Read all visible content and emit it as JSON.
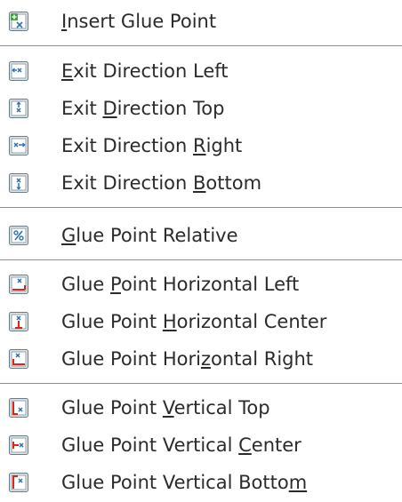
{
  "menu": {
    "items": [
      {
        "icon": "insert-glue-point-icon",
        "pre": "",
        "key": "I",
        "post": "nsert Glue Point"
      },
      {
        "icon": "exit-direction-left-icon",
        "pre": "",
        "key": "E",
        "post": "xit Direction Left"
      },
      {
        "icon": "exit-direction-top-icon",
        "pre": "Exit ",
        "key": "D",
        "post": "irection Top"
      },
      {
        "icon": "exit-direction-right-icon",
        "pre": "Exit Direction ",
        "key": "R",
        "post": "ight"
      },
      {
        "icon": "exit-direction-bottom-icon",
        "pre": "Exit Direction ",
        "key": "B",
        "post": "ottom"
      },
      {
        "icon": "glue-point-relative-icon",
        "pre": "",
        "key": "G",
        "post": "lue Point Relative"
      },
      {
        "icon": "glue-point-horizontal-left-icon",
        "pre": "Glue ",
        "key": "P",
        "post": "oint Horizontal Left"
      },
      {
        "icon": "glue-point-horizontal-center-icon",
        "pre": "Glue Point ",
        "key": "H",
        "post": "orizontal Center"
      },
      {
        "icon": "glue-point-horizontal-right-icon",
        "pre": "Glue Point Hori",
        "key": "z",
        "post": "ontal Right"
      },
      {
        "icon": "glue-point-vertical-top-icon",
        "pre": "Glue Point ",
        "key": "V",
        "post": "ertical Top"
      },
      {
        "icon": "glue-point-vertical-center-icon",
        "pre": "Glue Point Vertical ",
        "key": "C",
        "post": "enter"
      },
      {
        "icon": "glue-point-vertical-bottom-icon",
        "pre": "Glue Point Vertical Botto",
        "key": "m",
        "post": ""
      }
    ]
  }
}
